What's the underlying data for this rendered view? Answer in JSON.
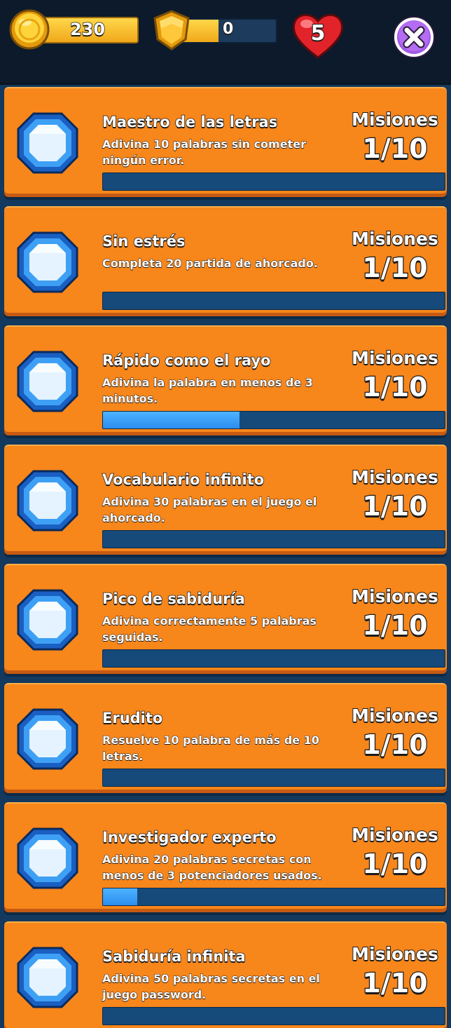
{
  "header": {
    "coins": "230",
    "shields": "0",
    "lives": "5",
    "icons": {
      "coin": "gold-coin-icon",
      "shield": "gold-shield-icon",
      "lives": "red-heart-icon",
      "close": "close-icon"
    }
  },
  "missions": [
    {
      "title": "Maestro de las letras",
      "description": "Adivina 10 palabras sin cometer ningún error.",
      "label": "Misiones",
      "count": "1/10",
      "progress": 0
    },
    {
      "title": "Sin estrés",
      "description": "Completa 20 partida de ahorcado.",
      "label": "Misiones",
      "count": "1/10",
      "progress": 0
    },
    {
      "title": "Rápido como el rayo",
      "description": "Adivina la palabra en menos de 3 minutos.",
      "label": "Misiones",
      "count": "1/10",
      "progress": 0.4
    },
    {
      "title": "Vocabulario infinito",
      "description": "Adivina 30 palabras en el juego el ahorcado.",
      "label": "Misiones",
      "count": "1/10",
      "progress": 0
    },
    {
      "title": "Pico de sabiduría",
      "description": "Adivina correctamente 5 palabras seguidas.",
      "label": "Misiones",
      "count": "1/10",
      "progress": 0
    },
    {
      "title": "Erudito",
      "description": "Resuelve 10 palabra de más de 10 letras.",
      "label": "Misiones",
      "count": "1/10",
      "progress": 0
    },
    {
      "title": "Investigador experto",
      "description": "Adivina 20 palabras secretas con menos de 3 potenciadores usados.",
      "label": "Misiones",
      "count": "1/10",
      "progress": 0.1
    },
    {
      "title": "Sabiduría infinita",
      "description": "Adivina 50 palabras secretas en el juego password.",
      "label": "Misiones",
      "count": "1/10",
      "progress": 0
    }
  ],
  "colors": {
    "card": "#f7861b",
    "background": "#13395e",
    "progress_fill": "#2b8ef0",
    "progress_track": "#154a7a"
  }
}
